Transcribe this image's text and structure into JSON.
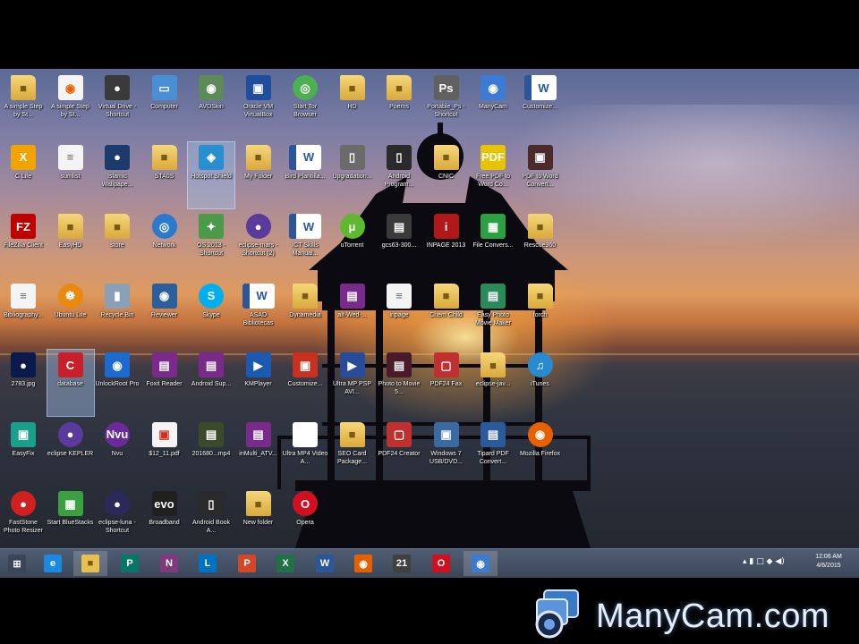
{
  "desktop_icons": [
    {
      "label": "A simple Step by St...",
      "glyph": "■",
      "kind": "folder",
      "icon": "folder-icon"
    },
    {
      "label": "A simple Step by St...",
      "glyph": "◉",
      "kind": "doc",
      "icon": "firefox-doc-icon",
      "color": "#e66000"
    },
    {
      "label": "Virtual Drive - Shortcut",
      "glyph": "●",
      "kind": "",
      "icon": "virtual-drive-icon",
      "color": "#3a3a3a"
    },
    {
      "label": "Computer",
      "glyph": "▭",
      "kind": "",
      "icon": "computer-icon",
      "color": "#4a8fd6"
    },
    {
      "label": "AVDSkin",
      "glyph": "◉",
      "kind": "",
      "icon": "eye-icon",
      "color": "#5e8a5a"
    },
    {
      "label": "Oracle VM VirtualBox",
      "glyph": "▣",
      "kind": "",
      "icon": "virtualbox-icon",
      "color": "#1f4f9c"
    },
    {
      "label": "Start Tor Browser",
      "glyph": "◎",
      "kind": "round",
      "icon": "tor-browser-icon",
      "color": "#4caf50"
    },
    {
      "label": "HD",
      "glyph": "■",
      "kind": "folder",
      "icon": "folder-icon"
    },
    {
      "label": "Poems",
      "glyph": "■",
      "kind": "folder",
      "icon": "folder-icon"
    },
    {
      "label": "Portable_Ps - Shortcut",
      "glyph": "Ps",
      "kind": "",
      "icon": "photoshop-icon",
      "color": "#606060"
    },
    {
      "label": "ManyCam",
      "glyph": "◉",
      "kind": "",
      "icon": "manycam-icon",
      "color": "#3b7bd4"
    },
    {
      "label": "Customize...",
      "glyph": "W",
      "kind": "word",
      "icon": "word-doc-icon"
    },
    {
      "label": "C Life",
      "glyph": "X",
      "kind": "",
      "icon": "x-app-icon",
      "color": "#f0a400"
    },
    {
      "label": "sumlist",
      "glyph": "≡",
      "kind": "doc",
      "icon": "text-file-icon"
    },
    {
      "label": "Islamic Wallpape...",
      "glyph": "●",
      "kind": "",
      "icon": "image-icon",
      "color": "#1c3a6b"
    },
    {
      "label": "STA0S",
      "glyph": "■",
      "kind": "folder",
      "icon": "user-folder-icon"
    },
    {
      "label": "Hotspot Shield",
      "glyph": "◈",
      "kind": "",
      "icon": "hotspot-shield-icon",
      "color": "#2a8fd0",
      "selected": true
    },
    {
      "label": "My Folder",
      "glyph": "■",
      "kind": "folder",
      "icon": "folder-icon"
    },
    {
      "label": "Bird Plantilla...",
      "glyph": "W",
      "kind": "word",
      "icon": "word-doc-icon"
    },
    {
      "label": "Upgradation...",
      "glyph": "▯",
      "kind": "",
      "icon": "phone-icon",
      "color": "#6b6b6b"
    },
    {
      "label": "Android Program...",
      "glyph": "▯",
      "kind": "",
      "icon": "android-phone-icon",
      "color": "#2a2a2a"
    },
    {
      "label": "CNIC",
      "glyph": "■",
      "kind": "folder",
      "icon": "folder-icon"
    },
    {
      "label": "Free PDF to Word Co...",
      "glyph": "PDF",
      "kind": "",
      "icon": "pdf-to-word-icon",
      "color": "#e8c400"
    },
    {
      "label": "PDF to Word Convert...",
      "glyph": "▣",
      "kind": "",
      "icon": "pdf-converter-icon",
      "color": "#4a2a2a"
    },
    {
      "label": "FileZilla Client",
      "glyph": "FZ",
      "kind": "",
      "icon": "filezilla-icon",
      "color": "#bf0000"
    },
    {
      "label": "EasyHD",
      "glyph": "■",
      "kind": "folder",
      "icon": "folder-icon"
    },
    {
      "label": "store",
      "glyph": "■",
      "kind": "folder",
      "icon": "folder-icon"
    },
    {
      "label": "Network",
      "glyph": "◎",
      "kind": "round",
      "icon": "network-globe-icon",
      "color": "#2b7ad0"
    },
    {
      "label": "OS.2013 - Shortcut",
      "glyph": "✦",
      "kind": "",
      "icon": "network-shortcut-icon",
      "color": "#4a9a4a"
    },
    {
      "label": "eclipse-mars - Shortcut (2)",
      "glyph": "●",
      "kind": "round",
      "icon": "eclipse-icon",
      "color": "#5a3a9a"
    },
    {
      "label": "ICT Skills Manual...",
      "glyph": "W",
      "kind": "word",
      "icon": "word-doc-icon"
    },
    {
      "label": "uTorrent",
      "glyph": "μ",
      "kind": "round",
      "icon": "utorrent-icon",
      "color": "#5fb830"
    },
    {
      "label": "gcs63-300...",
      "glyph": "▤",
      "kind": "",
      "icon": "archive-icon",
      "color": "#3a3a3a"
    },
    {
      "label": "INPAGE 2013",
      "glyph": "i",
      "kind": "",
      "icon": "inpage-icon",
      "color": "#b01818"
    },
    {
      "label": "File Convers...",
      "glyph": "▦",
      "kind": "",
      "icon": "file-converter-icon",
      "color": "#2aa040"
    },
    {
      "label": "Rescue360",
      "glyph": "■",
      "kind": "folder",
      "icon": "folder-icon"
    },
    {
      "label": "Bibliography...",
      "glyph": "≡",
      "kind": "doc",
      "icon": "text-file-icon"
    },
    {
      "label": "Ubuntu Lite",
      "glyph": "☸",
      "kind": "round",
      "icon": "ubuntu-icon",
      "color": "#e88a10"
    },
    {
      "label": "Recycle Bin",
      "glyph": "▮",
      "kind": "",
      "icon": "recycle-bin-icon",
      "color": "#8aa0b8"
    },
    {
      "label": "Reviewer",
      "glyph": "◉",
      "kind": "",
      "icon": "reviewer-icon",
      "color": "#2a5f9c"
    },
    {
      "label": "Skype",
      "glyph": "S",
      "kind": "round",
      "icon": "skype-icon",
      "color": "#00aff0"
    },
    {
      "label": "ASAD Bibliotecas",
      "glyph": "W",
      "kind": "word",
      "icon": "word-doc-icon"
    },
    {
      "label": "Dynamedia",
      "glyph": "■",
      "kind": "folder",
      "icon": "folder-icon"
    },
    {
      "label": "alt-Wed-...",
      "glyph": "▤",
      "kind": "",
      "icon": "winrar-icon",
      "color": "#7a2a8a"
    },
    {
      "label": "inpage",
      "glyph": "≡",
      "kind": "doc",
      "icon": "text-file-icon"
    },
    {
      "label": "Chem Child",
      "glyph": "■",
      "kind": "folder",
      "icon": "folder-icon"
    },
    {
      "label": "Easy Photo Movie Maker",
      "glyph": "▤",
      "kind": "",
      "icon": "movie-maker-icon",
      "color": "#2a8a5a"
    },
    {
      "label": "torch",
      "glyph": "■",
      "kind": "folder",
      "icon": "folder-icon"
    },
    {
      "label": "2783.jpg",
      "glyph": "●",
      "kind": "",
      "icon": "image-file-icon",
      "color": "#0a1a4a"
    },
    {
      "label": "database",
      "glyph": "C",
      "kind": "",
      "icon": "ccleaner-icon",
      "color": "#c8202a",
      "selected": true
    },
    {
      "label": "UnlockRoot Pro",
      "glyph": "◉",
      "kind": "",
      "icon": "unlockroot-icon",
      "color": "#1a6ad0"
    },
    {
      "label": "Foxit Reader",
      "glyph": "▤",
      "kind": "",
      "icon": "winrar-icon",
      "color": "#7a2a8a"
    },
    {
      "label": "Android Sup...",
      "glyph": "▤",
      "kind": "",
      "icon": "winrar-icon",
      "color": "#7a2a8a"
    },
    {
      "label": "KMPlayer",
      "glyph": "▶",
      "kind": "",
      "icon": "kmplayer-icon",
      "color": "#1a5ab0"
    },
    {
      "label": "Customize...",
      "glyph": "▣",
      "kind": "",
      "icon": "pdf-icon",
      "color": "#c83020"
    },
    {
      "label": "Ultra MP PSP AVI...",
      "glyph": "▶",
      "kind": "",
      "icon": "video-converter-icon",
      "color": "#2a4a9a"
    },
    {
      "label": "Photo to Movie 5...",
      "glyph": "▤",
      "kind": "",
      "icon": "photo-movie-icon",
      "color": "#4a1a2a"
    },
    {
      "label": "PDF24 Fax",
      "glyph": "▢",
      "kind": "",
      "icon": "pdf24-fax-icon",
      "color": "#c03030"
    },
    {
      "label": "eclipse-jav...",
      "glyph": "■",
      "kind": "folder",
      "icon": "folder-icon"
    },
    {
      "label": "iTunes",
      "glyph": "♫",
      "kind": "round",
      "icon": "itunes-icon",
      "color": "#2a8ad0"
    },
    {
      "label": "EasyFix",
      "glyph": "▣",
      "kind": "",
      "icon": "easyfix-icon",
      "color": "#1aa08a"
    },
    {
      "label": "eclipse KEPLER",
      "glyph": "●",
      "kind": "round",
      "icon": "eclipse-icon",
      "color": "#5a3a9a"
    },
    {
      "label": "Nvu",
      "glyph": "Nvu",
      "kind": "round",
      "icon": "nvu-icon",
      "color": "#6a2a9a"
    },
    {
      "label": "$12_11.pdf",
      "glyph": "▣",
      "kind": "doc",
      "icon": "pdf-file-icon",
      "color": "#d03020"
    },
    {
      "label": "201680...mp4",
      "glyph": "▤",
      "kind": "",
      "icon": "video-file-icon",
      "color": "#3a4a2a"
    },
    {
      "label": "inMulti_ATV...",
      "glyph": "▤",
      "kind": "",
      "icon": "winrar-icon",
      "color": "#7a2a8a"
    },
    {
      "label": "Ultra MP4 Video A...",
      "glyph": "●",
      "kind": "",
      "icon": "video-icon",
      "color": "#ffffff"
    },
    {
      "label": "SEO Card Package...",
      "glyph": "■",
      "kind": "folder",
      "icon": "folder-icon"
    },
    {
      "label": "PDF24 Creator",
      "glyph": "▢",
      "kind": "",
      "icon": "pdf24-creator-icon",
      "color": "#c03030"
    },
    {
      "label": "Windows 7 USB/DVD...",
      "glyph": "▣",
      "kind": "",
      "icon": "usb-dvd-tool-icon",
      "color": "#3a6aa0"
    },
    {
      "label": "Tipard PDF Convert...",
      "glyph": "▤",
      "kind": "",
      "icon": "pdf-converter-icon",
      "color": "#2a5a9a"
    },
    {
      "label": "Mozilla Firefox",
      "glyph": "◉",
      "kind": "round",
      "icon": "firefox-icon",
      "color": "#e66000"
    },
    {
      "label": "FastStone Photo Resizer",
      "glyph": "●",
      "kind": "round",
      "icon": "faststone-icon",
      "color": "#d02020"
    },
    {
      "label": "Start BlueStacks",
      "glyph": "▦",
      "kind": "",
      "icon": "bluestacks-icon",
      "color": "#3aa040"
    },
    {
      "label": "eclipse-luna - Shortcut",
      "glyph": "●",
      "kind": "round",
      "icon": "eclipse-icon",
      "color": "#2a2a5a"
    },
    {
      "label": "Broadband",
      "glyph": "evo",
      "kind": "",
      "icon": "evo-broadband-icon",
      "color": "#202020"
    },
    {
      "label": "Android Book A...",
      "glyph": "▯",
      "kind": "",
      "icon": "android-phone-icon",
      "color": "#2a2a2a"
    },
    {
      "label": "New folder",
      "glyph": "■",
      "kind": "folder",
      "icon": "folder-icon"
    },
    {
      "label": "Opera",
      "glyph": "O",
      "kind": "round",
      "icon": "opera-icon",
      "color": "#d01020"
    }
  ],
  "taskbar": {
    "items": [
      {
        "icon": "windows-start-icon",
        "glyph": "⊞",
        "color": "#3a4658"
      },
      {
        "icon": "internet-explorer-icon",
        "glyph": "e",
        "color": "#1a8ae0"
      },
      {
        "icon": "file-explorer-icon",
        "glyph": "■",
        "color": "#e8c050",
        "active": true
      },
      {
        "icon": "publisher-icon",
        "glyph": "P",
        "color": "#077568"
      },
      {
        "icon": "onenote-icon",
        "glyph": "N",
        "color": "#80397b"
      },
      {
        "icon": "lync-icon",
        "glyph": "L",
        "color": "#0072c6"
      },
      {
        "icon": "powerpoint-icon",
        "glyph": "P",
        "color": "#d24726"
      },
      {
        "icon": "excel-icon",
        "glyph": "X",
        "color": "#207245"
      },
      {
        "icon": "word-icon",
        "glyph": "W",
        "color": "#2b579a"
      },
      {
        "icon": "firefox-icon",
        "glyph": "◉",
        "color": "#e66000"
      },
      {
        "icon": "calendar-app-icon",
        "glyph": "21",
        "color": "#404040"
      },
      {
        "icon": "opera-icon",
        "glyph": "O",
        "color": "#d01020"
      },
      {
        "icon": "manycam-icon",
        "glyph": "◉",
        "color": "#3b7bd4",
        "active": true
      }
    ],
    "tray_glyphs": "▴  ▮ □ ◆ ◀)",
    "clock_time": "12:06 AM",
    "clock_date": "4/6/2015"
  },
  "watermark": {
    "text": "ManyCam.com"
  }
}
